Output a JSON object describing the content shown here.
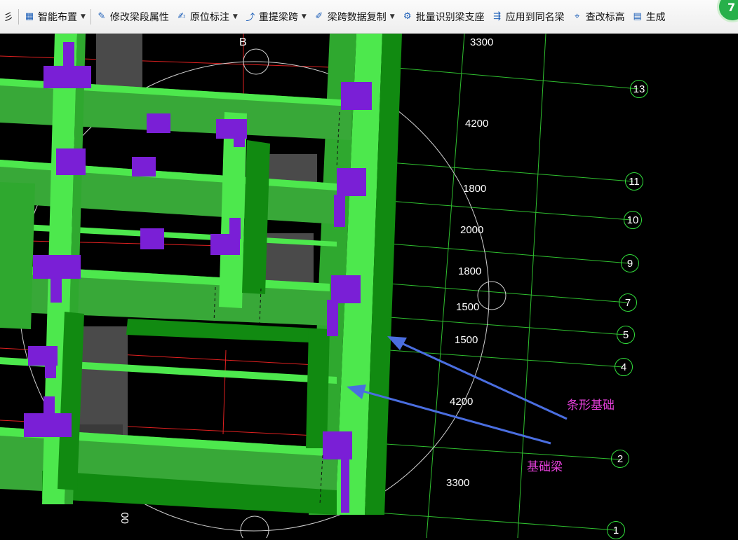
{
  "toolbar": {
    "items": [
      {
        "label": "彡",
        "icon": "partial-icon",
        "has_dropdown": false
      },
      {
        "label": "智能布置",
        "icon": "grid-layout-icon",
        "has_dropdown": true
      },
      {
        "label": "修改梁段属性",
        "icon": "beam-edit-icon",
        "has_dropdown": false
      },
      {
        "label": "原位标注",
        "icon": "annotate-icon",
        "has_dropdown": true
      },
      {
        "label": "重提梁跨",
        "icon": "beam-span-icon",
        "has_dropdown": true
      },
      {
        "label": "梁跨数据复制",
        "icon": "copy-brush-icon",
        "has_dropdown": true
      },
      {
        "label": "批量识别梁支座",
        "icon": "support-detect-icon",
        "has_dropdown": false
      },
      {
        "label": "应用到同名梁",
        "icon": "apply-beam-icon",
        "has_dropdown": false
      },
      {
        "label": "查改标高",
        "icon": "elevation-icon",
        "has_dropdown": false
      },
      {
        "label": "生成",
        "icon": "generate-icon",
        "has_dropdown": false
      }
    ],
    "badge": "7"
  },
  "axes": {
    "top_letter": "B",
    "bubbles": [
      "13",
      "11",
      "10",
      "9",
      "7",
      "5",
      "4",
      "2",
      "1"
    ],
    "dimensions": [
      "3300",
      "4200",
      "1800",
      "2000",
      "1800",
      "1500",
      "1500",
      "4200",
      "3300"
    ],
    "bottom_fragment": "00"
  },
  "annotations": {
    "strip_foundation": "条形基础",
    "foundation_beam": "基础梁"
  },
  "colors": {
    "beam_light": "#4de84d",
    "beam_mid": "#38a838",
    "beam_dark": "#118a11",
    "column_purple": "#7a1fd6",
    "pillar_gray": "#4a4a4a",
    "grid_green": "#2fbf2f",
    "grid_red": "#e02020",
    "annotation_text": "#e33fd8",
    "arrow_blue": "#4a6ee0"
  }
}
